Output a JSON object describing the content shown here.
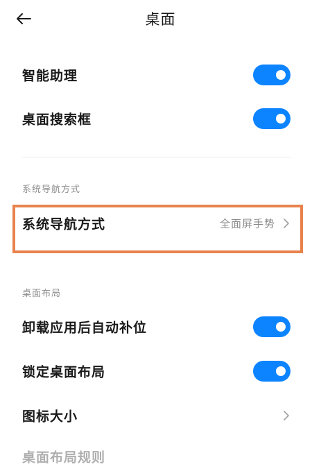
{
  "header": {
    "title": "桌面"
  },
  "toggles_top": [
    {
      "label": "智能助理",
      "on": true
    },
    {
      "label": "桌面搜索框",
      "on": true
    }
  ],
  "nav_section": {
    "header": "系统导航方式",
    "item": {
      "label": "系统导航方式",
      "value": "全面屏手势"
    }
  },
  "layout_section": {
    "header": "桌面布局",
    "items": [
      {
        "label": "卸载应用后自动补位",
        "on": true
      },
      {
        "label": "锁定桌面布局",
        "on": true
      },
      {
        "label": "图标大小"
      }
    ],
    "partial_label": "桌面布局规则"
  },
  "colors": {
    "toggle_on": "#0d84ff",
    "highlight": "#e8834e"
  },
  "icons": {
    "back": "arrow-left-icon",
    "chevron": "chevron-right-icon"
  }
}
